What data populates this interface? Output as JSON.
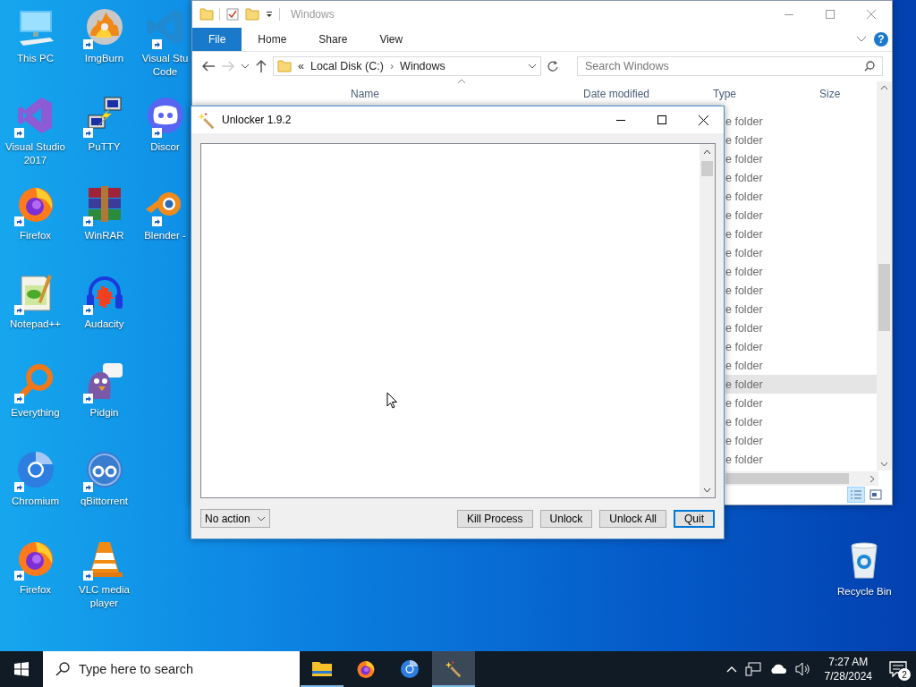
{
  "desktop_icons": [
    {
      "lines": [
        "This PC"
      ],
      "kind": "pc",
      "shortcut": false
    },
    {
      "lines": [
        "Visual Studio",
        "2017"
      ],
      "kind": "vs",
      "shortcut": true
    },
    {
      "lines": [
        "Firefox"
      ],
      "kind": "firefox",
      "shortcut": true
    },
    {
      "lines": [
        "Notepad++"
      ],
      "kind": "notepad",
      "shortcut": true
    },
    {
      "lines": [
        "Everything"
      ],
      "kind": "everything",
      "shortcut": true
    },
    {
      "lines": [
        "Chromium"
      ],
      "kind": "chromium",
      "shortcut": true
    },
    {
      "lines": [
        "Firefox"
      ],
      "kind": "firefox",
      "shortcut": true
    },
    {
      "lines": [
        "ImgBurn"
      ],
      "kind": "disc",
      "shortcut": true
    },
    {
      "lines": [
        "PuTTY"
      ],
      "kind": "putty",
      "shortcut": true
    },
    {
      "lines": [
        "WinRAR"
      ],
      "kind": "winrar",
      "shortcut": true
    },
    {
      "lines": [
        "Audacity"
      ],
      "kind": "audacity",
      "shortcut": true
    },
    {
      "lines": [
        "Pidgin"
      ],
      "kind": "pidgin",
      "shortcut": true
    },
    {
      "lines": [
        "qBittorrent"
      ],
      "kind": "qbit",
      "shortcut": true
    },
    {
      "lines": [
        "VLC media",
        "player"
      ],
      "kind": "vlc",
      "shortcut": true
    },
    {
      "lines": [
        "Visual Stu",
        "Code"
      ],
      "kind": "vscode",
      "shortcut": true
    },
    {
      "lines": [
        "Discor"
      ],
      "kind": "discord",
      "shortcut": true
    },
    {
      "lines": [
        "Blender -"
      ],
      "kind": "blender",
      "shortcut": true
    }
  ],
  "recycle_bin": {
    "lines": [
      "Recycle Bin"
    ],
    "kind": "recycle"
  },
  "explorer": {
    "title": "Windows",
    "ribbon_tabs": [
      {
        "label": "File",
        "selected": true
      },
      {
        "label": "Home",
        "selected": false
      },
      {
        "label": "Share",
        "selected": false
      },
      {
        "label": "View",
        "selected": false
      }
    ],
    "help_label": "?",
    "address": {
      "overflow": "«",
      "segments": [
        "Local Disk (C:)",
        "Windows"
      ],
      "separator": "›"
    },
    "search": {
      "placeholder": "Search Windows"
    },
    "columns": [
      "Name",
      "Date modified",
      "Type",
      "Size"
    ],
    "rows": [
      {
        "type": "e folder",
        "selected": false
      },
      {
        "type": "e folder",
        "selected": false
      },
      {
        "type": "e folder",
        "selected": false
      },
      {
        "type": "e folder",
        "selected": false
      },
      {
        "type": "e folder",
        "selected": false
      },
      {
        "type": "e folder",
        "selected": false
      },
      {
        "type": "e folder",
        "selected": false
      },
      {
        "type": "e folder",
        "selected": false
      },
      {
        "type": "e folder",
        "selected": false
      },
      {
        "type": "e folder",
        "selected": false
      },
      {
        "type": "e folder",
        "selected": false
      },
      {
        "type": "e folder",
        "selected": false
      },
      {
        "type": "e folder",
        "selected": false
      },
      {
        "type": "e folder",
        "selected": false
      },
      {
        "type": "e folder",
        "selected": true
      },
      {
        "type": "e folder",
        "selected": false
      },
      {
        "type": "e folder",
        "selected": false
      },
      {
        "type": "e folder",
        "selected": false
      },
      {
        "type": "e folder",
        "selected": false
      }
    ]
  },
  "unlocker": {
    "title": "Unlocker 1.9.2",
    "action": {
      "value": "No action"
    },
    "buttons": [
      {
        "label": "Kill Process",
        "default": false
      },
      {
        "label": "Unlock",
        "default": false
      },
      {
        "label": "Unlock All",
        "default": false
      },
      {
        "label": "Quit",
        "default": true
      }
    ]
  },
  "taskbar": {
    "search": {
      "placeholder": "Type here to search"
    },
    "apps": [
      {
        "kind": "explorer",
        "running": true,
        "selected": false
      },
      {
        "kind": "firefox",
        "running": false,
        "selected": false
      },
      {
        "kind": "chromium",
        "running": false,
        "selected": false
      },
      {
        "kind": "unlocker",
        "running": true,
        "selected": true
      }
    ],
    "time": "7:27 AM",
    "date": "7/28/2024",
    "notifications": "2"
  }
}
